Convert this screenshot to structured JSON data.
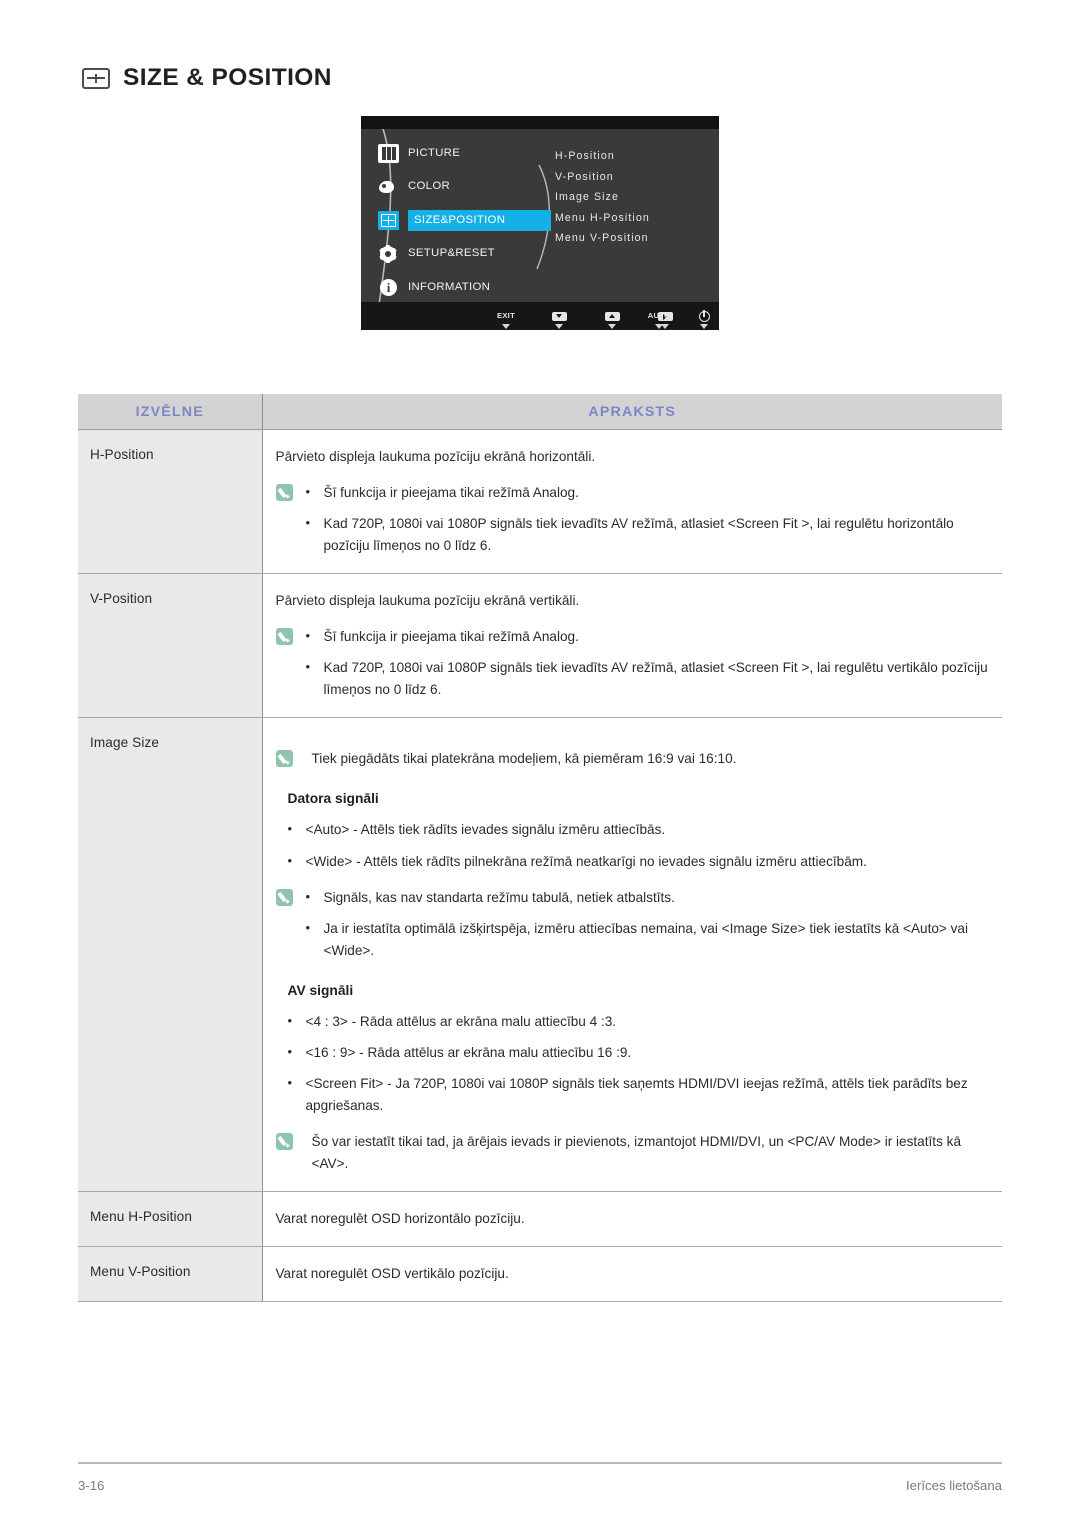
{
  "page": {
    "title": "SIZE & POSITION",
    "title_icon": "size-position-icon",
    "footer_page_number": "3-16",
    "footer_section": "Ierīces lietošana"
  },
  "osd": {
    "menu_items": [
      {
        "label": "PICTURE",
        "icon": "picture-icon",
        "selected": false
      },
      {
        "label": "COLOR",
        "icon": "color-icon",
        "selected": false
      },
      {
        "label": "SIZE&POSITION",
        "icon": "size-position-icon",
        "selected": true
      },
      {
        "label": "SETUP&RESET",
        "icon": "gear-icon",
        "selected": false
      },
      {
        "label": "INFORMATION",
        "icon": "info-icon",
        "selected": false
      }
    ],
    "submenu_items": [
      "H-Position",
      "V-Position",
      "Image Size",
      "Menu H-Position",
      "Menu V-Position"
    ],
    "key_bar": [
      {
        "name": "exit-key",
        "label": "EXIT",
        "glyph": "text"
      },
      {
        "name": "down-key",
        "label": "",
        "glyph": "down-arrow-icon"
      },
      {
        "name": "up-key",
        "label": "",
        "glyph": "up-arrow-icon"
      },
      {
        "name": "enter-key",
        "label": "",
        "glyph": "right-arrow-icon"
      },
      {
        "name": "auto-key",
        "label": "AUTO",
        "glyph": "text"
      },
      {
        "name": "power-key",
        "label": "",
        "glyph": "power-icon"
      }
    ],
    "highlight_color": "#16b0e8"
  },
  "table": {
    "headers": {
      "menu": "IZVĒLNE",
      "description": "APRAKSTS"
    },
    "header_text_color": "#7d86c4",
    "header_bg_color": "#d3d3d3",
    "rows": [
      {
        "menu": "H-Position",
        "lead": "Pārvieto displeja laukuma pozīciju ekrānā horizontāli.",
        "note_bullets": [
          "Šī funkcija ir pieejama tikai režīmā Analog.",
          "Kad 720P, 1080i vai 1080P signāls tiek ievadīts AV režīmā, atlasiet <Screen Fit  >, lai regulētu horizontālo pozīciju līmeņos no 0 līdz 6."
        ]
      },
      {
        "menu": "V-Position",
        "lead": "Pārvieto displeja laukuma pozīciju ekrānā vertikāli.",
        "note_bullets": [
          "Šī funkcija ir pieejama tikai režīmā Analog.",
          "Kad 720P, 1080i vai 1080P signāls tiek ievadīts AV režīmā, atlasiet <Screen Fit  >, lai regulētu vertikālo pozīciju līmeņos no 0 līdz 6."
        ]
      },
      {
        "menu": "Image Size",
        "note_top": "Tiek piegādāts tikai platekrāna modeļiem, kā piemēram 16:9 vai 16:10.",
        "section_1_heading": "Datora signāli",
        "section_1_bullets": [
          "<Auto> - Attēls tiek rādīts ievades signālu izmēru attiecībās.",
          "<Wide> - Attēls tiek rādīts pilnekrāna režīmā neatkarīgi no ievades signālu izmēru attiecībām."
        ],
        "note_bullets": [
          "Signāls, kas nav standarta režīmu tabulā, netiek atbalstīts.",
          "Ja ir iestatīta optimālā izšķirtspēja, izmēru attiecības nemaina, vai <Image Size> tiek iestatīts kā <Auto> vai <Wide>."
        ],
        "section_2_heading": "AV signāli",
        "section_2_bullets": [
          "<4 : 3> - Rāda attēlus ar ekrāna malu attiecību 4 :3.",
          "<16 : 9> - Rāda attēlus ar ekrāna malu attiecību 16 :9.",
          "<Screen Fit> - Ja 720P, 1080i vai 1080P signāls tiek saņemts HDMI/DVI ieejas režīmā, attēls tiek parādīts bez apgriešanas."
        ],
        "note_bottom": "Šo var iestatīt tikai tad, ja ārējais ievads ir pievienots, izmantojot HDMI/DVI, un <PC/AV Mode> ir iestatīts kā <AV>."
      },
      {
        "menu": "Menu H-Position",
        "lead": "Varat noregulēt OSD horizontālo pozīciju."
      },
      {
        "menu": "Menu V-Position",
        "lead": "Varat noregulēt OSD vertikālo pozīciju."
      }
    ]
  }
}
